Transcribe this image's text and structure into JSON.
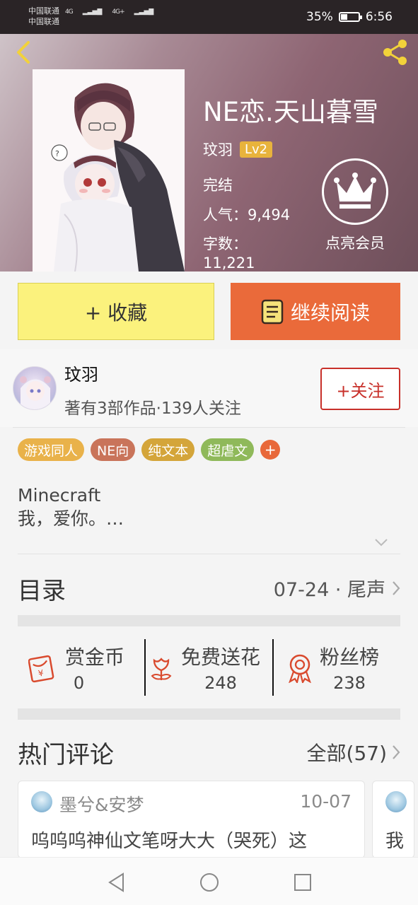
{
  "status_bar": {
    "carrier_1": "中国联通",
    "carrier_2": "中国联通",
    "signal_1": "4G",
    "signal_2": "4G+",
    "battery": "35%",
    "time": "6:56"
  },
  "book": {
    "title": "NE恋.天山暮雪",
    "author": "玟羽",
    "level": "Lv2",
    "status": "完结",
    "popularity": "人气：9,494",
    "word_count_label": "字数：",
    "word_count_value": "11,221",
    "vip_label": "点亮会员"
  },
  "actions": {
    "favorite": "+ 收藏",
    "continue_reading": "继续阅读"
  },
  "author_card": {
    "name": "玟羽",
    "works": "著有3部作品·139人关注",
    "follow": "+关注"
  },
  "tags": [
    {
      "label": "游戏同人",
      "color": "#e9b24a"
    },
    {
      "label": "NE向",
      "color": "#c9745a"
    },
    {
      "label": "纯文本",
      "color": "#d4a53a"
    },
    {
      "label": "超虐文",
      "color": "#8fb95a"
    }
  ],
  "tag_add": "+",
  "description": {
    "line1": "Minecraft",
    "line2": "我，爱你。…"
  },
  "catalog": {
    "title": "目录",
    "latest": "07-24 · 尾声"
  },
  "stats": [
    {
      "label": "赏金币",
      "value": "0",
      "icon": "red-packet-icon"
    },
    {
      "label": "免费送花",
      "value": "248",
      "icon": "flower-icon"
    },
    {
      "label": "粉丝榜",
      "value": "238",
      "icon": "medal-icon"
    }
  ],
  "comments": {
    "title": "热门评论",
    "all": "全部(57)",
    "items": [
      {
        "user": "墨兮&安梦",
        "date": "10-07",
        "text": "呜呜呜神仙文笔呀大大（哭死）这"
      },
      {
        "text": "我"
      }
    ]
  },
  "colors": {
    "accent_orange": "#ea6a3a",
    "favorite_yellow": "#fbf27d",
    "follow_red": "#c8302a",
    "icon_red": "#d94a2e",
    "level_gold": "#e8b33c"
  }
}
